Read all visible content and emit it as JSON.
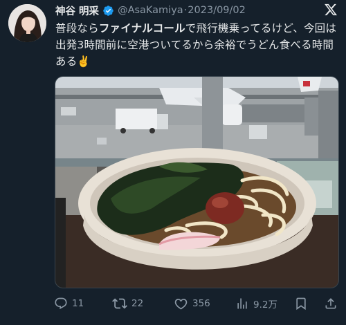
{
  "tweet": {
    "author": {
      "display_name": "神谷 明采",
      "handle": "@AsaKamiya",
      "separator": "·",
      "date": "2023/09/02",
      "verified": true
    },
    "text": {
      "part1": "普段なら",
      "bold": "ファイナルコール",
      "part2": "で飛行機乗ってるけど、今回は出発3時間前に空港ついてるから余裕でうどん食べる時間ある",
      "emoji": "✌️"
    },
    "media": {
      "icon": "photo"
    },
    "actions": {
      "reply_count": "11",
      "retweet_count": "22",
      "like_count": "356",
      "view_count": "9.2万"
    }
  },
  "colors": {
    "background": "#15202b",
    "verified_blue": "#1d9bf0",
    "muted_text": "#8b98a5",
    "text": "#e7e9ea"
  }
}
